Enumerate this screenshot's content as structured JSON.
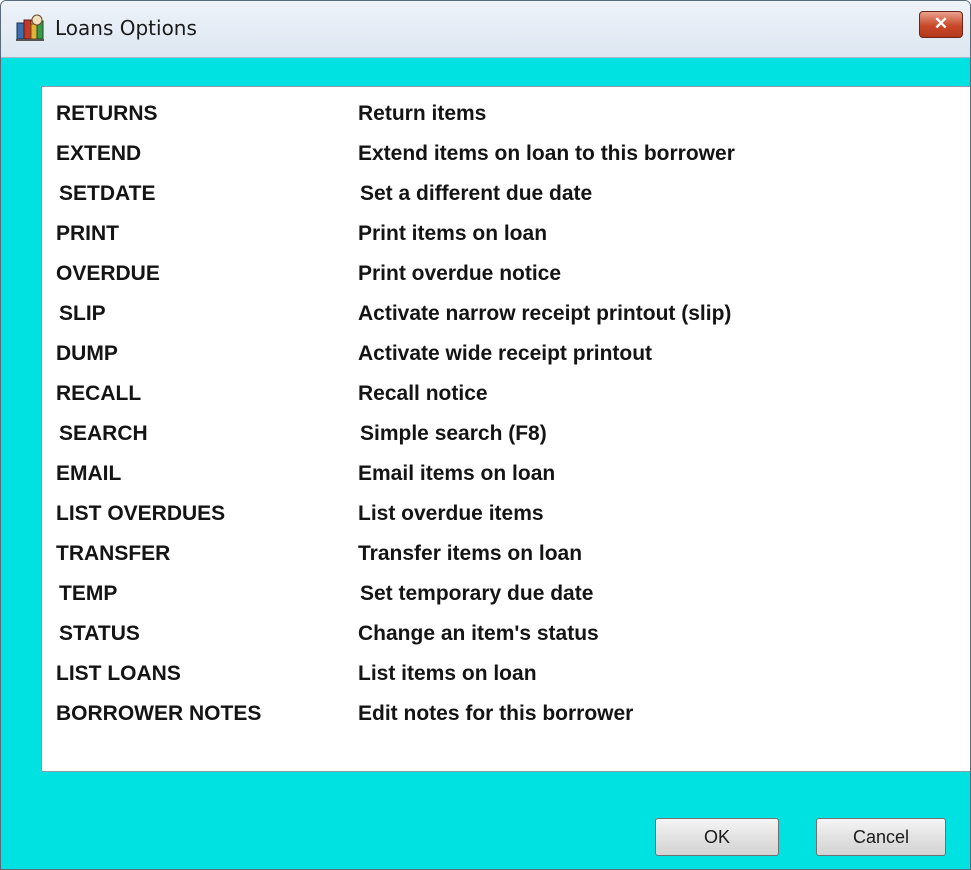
{
  "window": {
    "title": "Loans Options",
    "close_glyph": "✕",
    "icon": "library-app-icon"
  },
  "options": [
    {
      "code": "RETURNS",
      "desc": "Return items"
    },
    {
      "code": "EXTEND",
      "desc": "Extend items on loan to this borrower"
    },
    {
      "code": "SETDATE",
      "desc": "Set a different due date"
    },
    {
      "code": "PRINT",
      "desc": "Print items on loan"
    },
    {
      "code": "OVERDUE",
      "desc": "Print overdue notice"
    },
    {
      "code": "SLIP",
      "desc": "Activate narrow receipt printout (slip)"
    },
    {
      "code": "DUMP",
      "desc": "Activate wide receipt printout"
    },
    {
      "code": "RECALL",
      "desc": "Recall notice"
    },
    {
      "code": "SEARCH",
      "desc": "Simple search (F8)"
    },
    {
      "code": "EMAIL",
      "desc": "Email items on loan"
    },
    {
      "code": "LIST OVERDUES",
      "desc": "List overdue items"
    },
    {
      "code": "TRANSFER",
      "desc": "Transfer items on loan"
    },
    {
      "code": "TEMP",
      "desc": "Set temporary due date"
    },
    {
      "code": "STATUS",
      "desc": "Change an item's status"
    },
    {
      "code": "LIST LOANS",
      "desc": "List items on loan"
    },
    {
      "code": "BORROWER NOTES",
      "desc": "Edit notes for this borrower"
    }
  ],
  "buttons": {
    "ok": "OK",
    "cancel": "Cancel"
  },
  "colors": {
    "client_background": "#00e2e2",
    "close_button": "#c84a2a"
  }
}
